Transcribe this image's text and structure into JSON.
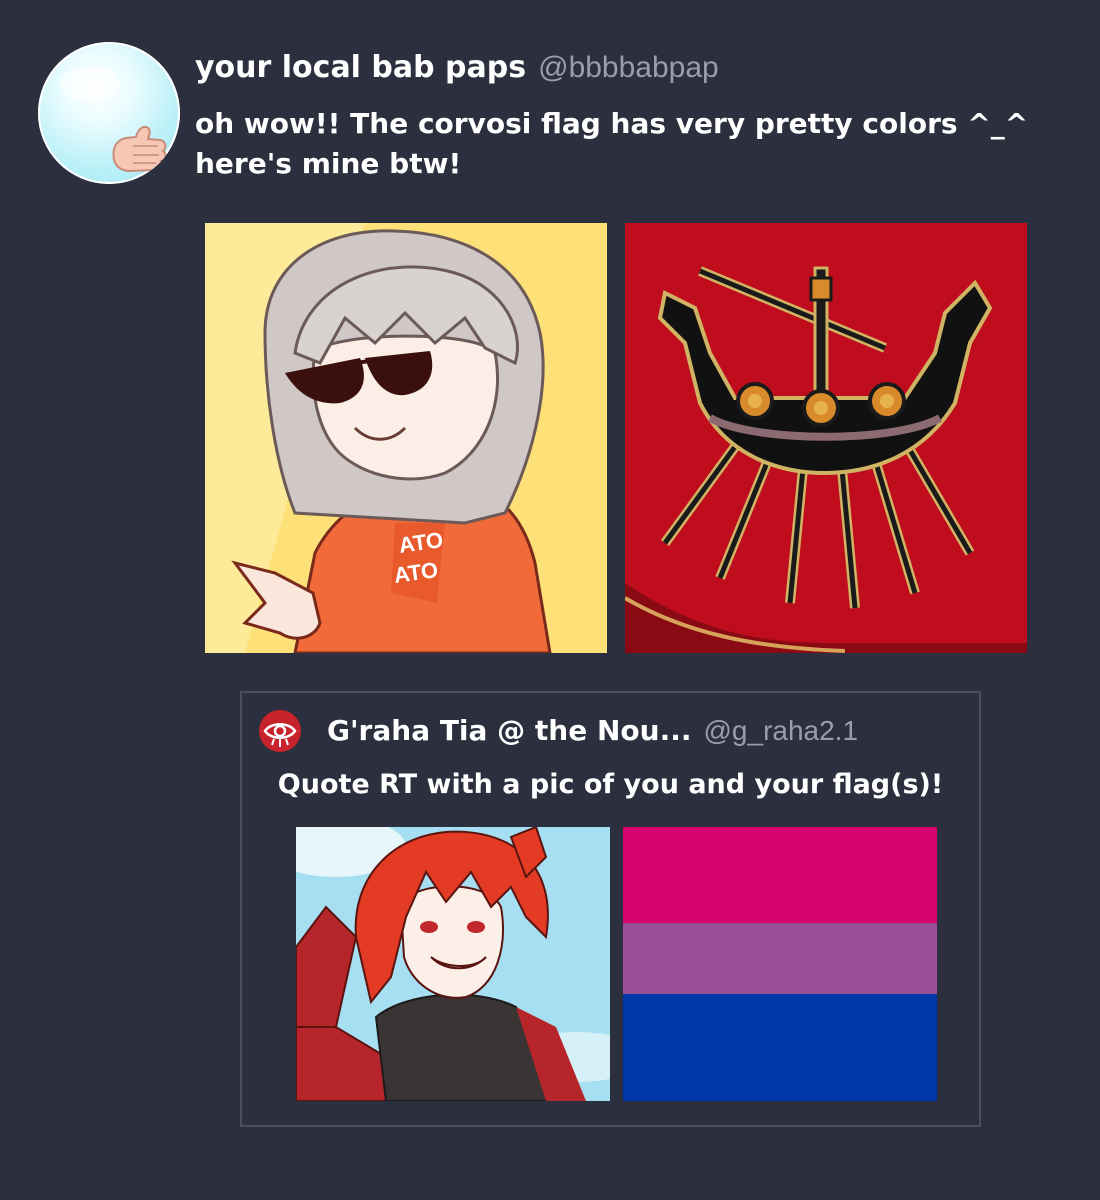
{
  "post": {
    "author_name": "your local bab paps",
    "author_handle": "@bbbbabpap",
    "text_line1": "oh wow!! The corvosi flag has very pretty colors ^_^",
    "text_line2": "here's mine btw!",
    "avatar_icon": "thumbs-up-icon",
    "images": [
      "selfie-illustration",
      "corvosi-flag"
    ]
  },
  "quote": {
    "author_name": "G'raha Tia @ the Nou...",
    "author_handle": "@g_raha2.1",
    "text": "Quote RT with a pic of you and your flag(s)!",
    "avatar_icon": "crystal-eye-emblem-icon",
    "images": [
      "graha-selfie-illustration",
      "bisexual-flag"
    ],
    "bi_flag_colors": [
      "#d60270",
      "#9b4f96",
      "#0038a8"
    ]
  },
  "theme": {
    "background": "#2b2f3e",
    "text": "#ffffff",
    "muted": "#9a9ea8",
    "flag_red": "#c00d1e"
  }
}
